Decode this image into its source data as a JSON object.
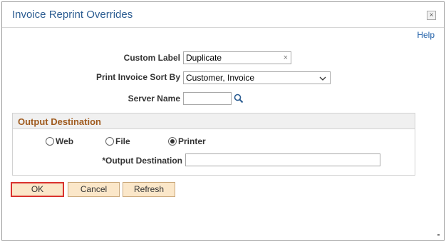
{
  "dialog": {
    "title": "Invoice Reprint Overrides",
    "close_symbol": "×",
    "help_label": "Help"
  },
  "form": {
    "custom_label": {
      "label": "Custom Label",
      "value": "Duplicate",
      "clear_symbol": "×"
    },
    "sort_by": {
      "label": "Print Invoice Sort By",
      "value": "Customer, Invoice"
    },
    "server_name": {
      "label": "Server Name",
      "value": ""
    }
  },
  "output_group": {
    "title": "Output Destination",
    "options": [
      {
        "label": "Web",
        "checked": false
      },
      {
        "label": "File",
        "checked": false
      },
      {
        "label": "Printer",
        "checked": true
      }
    ],
    "destination": {
      "label": "*Output Destination",
      "value": ""
    }
  },
  "buttons": {
    "ok": "OK",
    "cancel": "Cancel",
    "refresh": "Refresh"
  },
  "colors": {
    "title": "#2b5c91",
    "group_title": "#a05c20",
    "button_bg": "#fbe7c9",
    "primary_border": "#d9332f"
  }
}
